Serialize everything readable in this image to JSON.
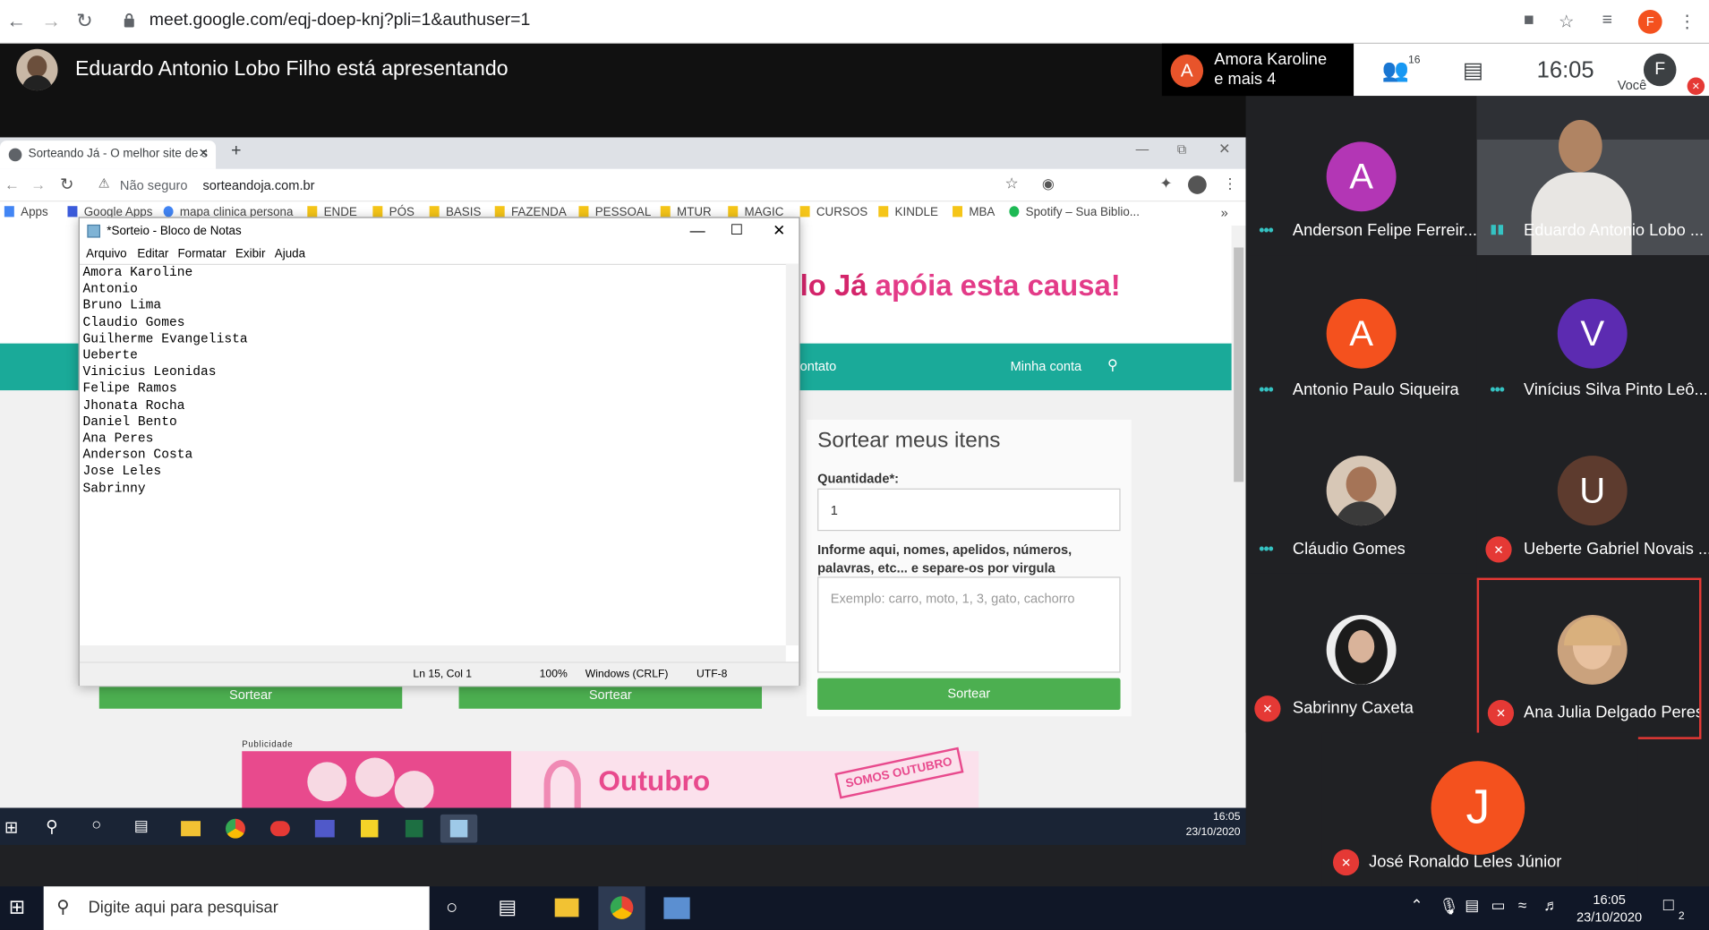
{
  "browser": {
    "url": "meet.google.com/eqj-doep-knj?pli=1&authuser=1",
    "profile_initial": "F"
  },
  "meet": {
    "presenter_text": "Eduardo Antonio Lobo Filho está apresentando",
    "notification": {
      "avatar_initial": "A",
      "line1": "Amora Karoline",
      "line2": "e mais 4"
    },
    "participants_count": "16",
    "time": "16:05",
    "self": {
      "initial": "F",
      "label": "Você"
    },
    "tiles": [
      {
        "name": "Anderson Felipe Ferreir...",
        "initial": "A",
        "color": "#b336b5",
        "status": "dots"
      },
      {
        "name": "Eduardo Antonio Lobo ...",
        "initial": "",
        "color": "",
        "status": "speaking"
      },
      {
        "name": "Antonio Paulo Siqueira",
        "initial": "A",
        "color": "#f4511e",
        "status": "dots"
      },
      {
        "name": "Vinícius Silva Pinto Leô...",
        "initial": "V",
        "color": "#5c2bb1",
        "status": "dots"
      },
      {
        "name": "Cláudio Gomes",
        "initial": "",
        "color": "",
        "status": "dots"
      },
      {
        "name": "Ueberte Gabriel Novais ...",
        "initial": "U",
        "color": "#5d3b2e",
        "status": "muted"
      },
      {
        "name": "Sabrinny Caxeta",
        "initial": "",
        "color": "",
        "status": "muted"
      },
      {
        "name": "Ana Julia Delgado Peres",
        "initial": "",
        "color": "",
        "status": "muted"
      },
      {
        "name": "José Ronaldo Leles Júnior",
        "initial": "J",
        "color": "#f4511e",
        "status": "muted"
      }
    ]
  },
  "shared": {
    "tab_title": "Sorteando Já - O melhor site de s",
    "insecure": "Não seguro",
    "url": "sorteandoja.com.br",
    "bookmarks": [
      "Apps",
      "Google Apps",
      "mapa clinica persona",
      "ENDE",
      "PÓS",
      "BASIS",
      "FAZENDA",
      "PESSOAL",
      "MTUR",
      "MAGIC",
      "CURSOS",
      "KINDLE",
      "MBA",
      "Spotify – Sua Biblio..."
    ],
    "headline_a": "lo Já",
    "headline_b": "apóia esta causa!",
    "nav": [
      "ontato",
      "Minha conta"
    ],
    "card": {
      "title": "Sortear meus itens",
      "qty_label": "Quantidade*:",
      "qty_value": "1",
      "names_label": "Informe aqui, nomes, apelidos, números, palavras, etc... e separe-os por virgula",
      "names_placeholder": "Exemplo: carro, moto, 1, 3, gato, cachorro",
      "button": "Sortear"
    },
    "hidden_buttons": [
      "Sortear",
      "Sortear"
    ],
    "publicidade": "Publicidade",
    "ad_text": "Outubro",
    "ad_badge": "SOMOS OUTUBRO",
    "taskbar_time": "16:05",
    "taskbar_date": "23/10/2020"
  },
  "notepad": {
    "title": "*Sorteio - Bloco de Notas",
    "menu": [
      "Arquivo",
      "Editar",
      "Formatar",
      "Exibir",
      "Ajuda"
    ],
    "lines": [
      "Amora Karoline",
      "Antonio",
      "Bruno Lima",
      "Claudio Gomes",
      "Guilherme Evangelista",
      "Ueberte",
      "Vinicius Leonidas",
      "Felipe Ramos",
      "Jhonata Rocha",
      "Daniel Bento",
      "Ana Peres",
      "Anderson Costa",
      "Jose Leles",
      "Sabrinny"
    ],
    "status": {
      "pos": "Ln 15, Col 1",
      "zoom": "100%",
      "eol": "Windows (CRLF)",
      "enc": "UTF-8"
    }
  },
  "os": {
    "search_placeholder": "Digite aqui para pesquisar",
    "time": "16:05",
    "date": "23/10/2020",
    "notifications": "2"
  }
}
